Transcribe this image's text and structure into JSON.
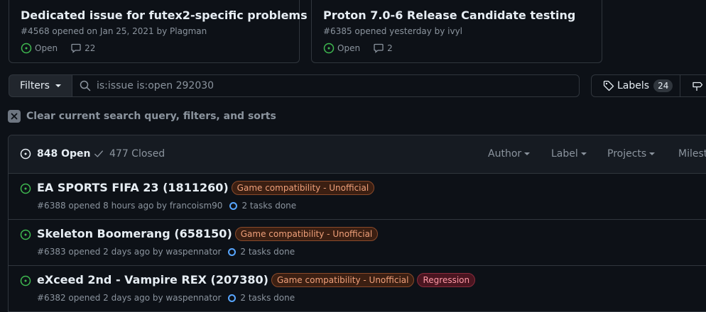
{
  "pinned": [
    {
      "title": "Dedicated issue for futex2-specific problems",
      "meta": "#4568 opened on Jan 25, 2021 by Plagman",
      "status": "Open",
      "comments": "22"
    },
    {
      "title": "Proton 7.0-6 Release Candidate testing",
      "meta": "#6385 opened yesterday by ivyl",
      "status": "Open",
      "comments": "2"
    }
  ],
  "toolbar": {
    "filters_label": "Filters",
    "search_value": "is:issue is:open 292030",
    "labels_label": "Labels",
    "labels_count": "24"
  },
  "clear_label": "Clear current search query, filters, and sorts",
  "header": {
    "open_label": "848 Open",
    "closed_label": "477 Closed",
    "author_label": "Author",
    "label_label": "Label",
    "projects_label": "Projects",
    "milestones_label": "Milest"
  },
  "issues": [
    {
      "title": "EA SPORTS FIFA 23 (1811260)",
      "labels": [
        "Game compatibility - Unofficial"
      ],
      "meta": "#6388 opened 8 hours ago by francoism90",
      "tasks": "2 tasks done"
    },
    {
      "title": "Skeleton Boomerang (658150)",
      "labels": [
        "Game compatibility - Unofficial"
      ],
      "meta": "#6383 opened 2 days ago by waspennator",
      "tasks": "2 tasks done"
    },
    {
      "title": "eXceed 2nd - Vampire REX (207380)",
      "labels": [
        "Game compatibility - Unofficial",
        "Regression"
      ],
      "meta": "#6382 opened 2 days ago by waspennator",
      "tasks": "2 tasks done"
    }
  ],
  "colors": {
    "open_green": "#3fb950",
    "compat_label": "#f0a07a",
    "regression_label": "#ff9aa7",
    "task_blue": "#58a6ff"
  }
}
